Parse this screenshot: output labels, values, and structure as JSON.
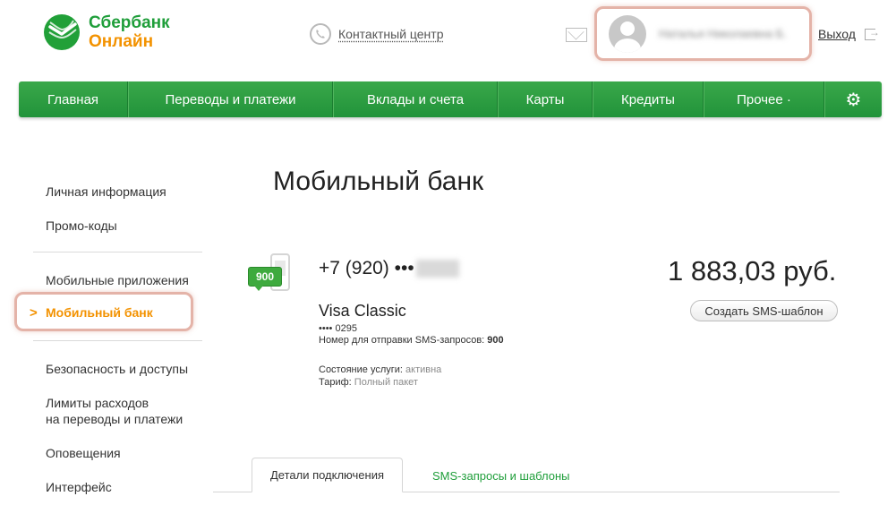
{
  "header": {
    "logo_line1": "Сбербанк",
    "logo_line2": "Онлайн",
    "contact_center": "Контактный центр",
    "user_name": "Наталья Николаевна Б.",
    "logout": "Выход"
  },
  "nav": {
    "items": [
      {
        "label": "Главная"
      },
      {
        "label": "Переводы и платежи"
      },
      {
        "label": "Вклады и счета"
      },
      {
        "label": "Карты"
      },
      {
        "label": "Кредиты"
      },
      {
        "label": "Прочее ·"
      }
    ],
    "settings_icon": "gear-icon"
  },
  "sidebar": {
    "items": [
      {
        "label": "Личная информация"
      },
      {
        "label": "Промо-коды"
      },
      {
        "label": "Мобильные приложения"
      },
      {
        "label": "Мобильный банк",
        "active": true
      },
      {
        "label": "Безопасность и доступы"
      },
      {
        "label": "Лимиты расходов"
      },
      {
        "label": "на переводы и платежи"
      },
      {
        "label": "Оповещения"
      },
      {
        "label": "Интерфейс"
      }
    ]
  },
  "main": {
    "title": "Мобильный банк",
    "badge": "900",
    "phone_number": "+7 (920) •••",
    "card_name": "Visa Classic",
    "card_number": "•••• 0295",
    "sms_number_label": "Номер для отправки SMS-запросов:",
    "sms_number_value": "900",
    "status_label": "Состояние услуги:",
    "status_value": "активна",
    "tariff_label": "Тариф:",
    "tariff_value": "Полный пакет",
    "balance": "1 883,03 руб.",
    "create_sms_button": "Создать SMS-шаблон"
  },
  "tabs": [
    {
      "label": "Детали подключения",
      "active": true
    },
    {
      "label": "SMS-запросы и шаблоны",
      "active": false
    }
  ],
  "colors": {
    "brand_green": "#21933a",
    "brand_orange": "#f39200",
    "highlight_border": "#e4b3a8"
  }
}
